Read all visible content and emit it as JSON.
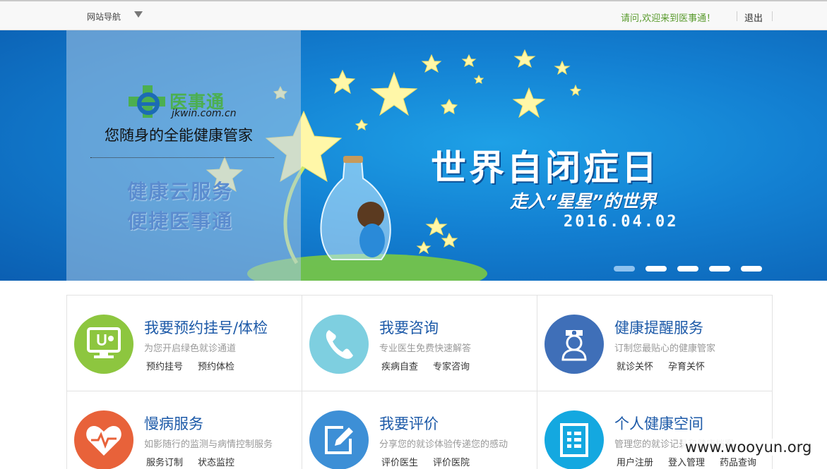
{
  "topbar": {
    "nav_menu": "网站导航",
    "welcome": "请问,欢迎来到医事通！",
    "logout": "退出"
  },
  "banner": {
    "logo_name": "医事通",
    "logo_url": "jkwin.com.cn",
    "tagline": "您随身的全能健康管家",
    "slogan_line1": "健康云服务",
    "slogan_line2": "便捷医事通",
    "title": "世界自闭症日",
    "subtitle": "走入“星星”的世界",
    "date": "2016.04.02",
    "slide_count": 5,
    "active_slide": 1
  },
  "services": [
    {
      "title": "我要预约挂号/体检",
      "desc": "为您开启绿色就诊通道",
      "links": [
        "预约挂号",
        "预约体检"
      ],
      "icon": "monitor-stethoscope-icon",
      "color": "#8dc63f"
    },
    {
      "title": "我要咨询",
      "desc": "专业医生免费快速解答",
      "links": [
        "疾病自查",
        "专家咨询"
      ],
      "icon": "phone-icon",
      "color": "#7ecfe0"
    },
    {
      "title": "健康提醒服务",
      "desc": "订制您最贴心的健康管家",
      "links": [
        "就诊关怀",
        "孕育关怀"
      ],
      "icon": "nurse-icon",
      "color": "#3f6fb8"
    },
    {
      "title": "慢病服务",
      "desc": "如影随行的监测与病情控制服务",
      "links": [
        "服务订制",
        "状态监控"
      ],
      "icon": "heart-pulse-icon",
      "color": "#e8623a"
    },
    {
      "title": "我要评价",
      "desc": "分享您的就诊体验传递您的感动",
      "links": [
        "评价医生",
        "评价医院"
      ],
      "icon": "edit-icon",
      "color": "#3d8fd6"
    },
    {
      "title": "个人健康空间",
      "desc": "管理您的就诊记录和健康档案",
      "links": [
        "用户注册",
        "登入管理",
        "药品查询"
      ],
      "icon": "record-list-icon",
      "color": "#14a8e0"
    }
  ],
  "watermark": "www.wooyun.org"
}
